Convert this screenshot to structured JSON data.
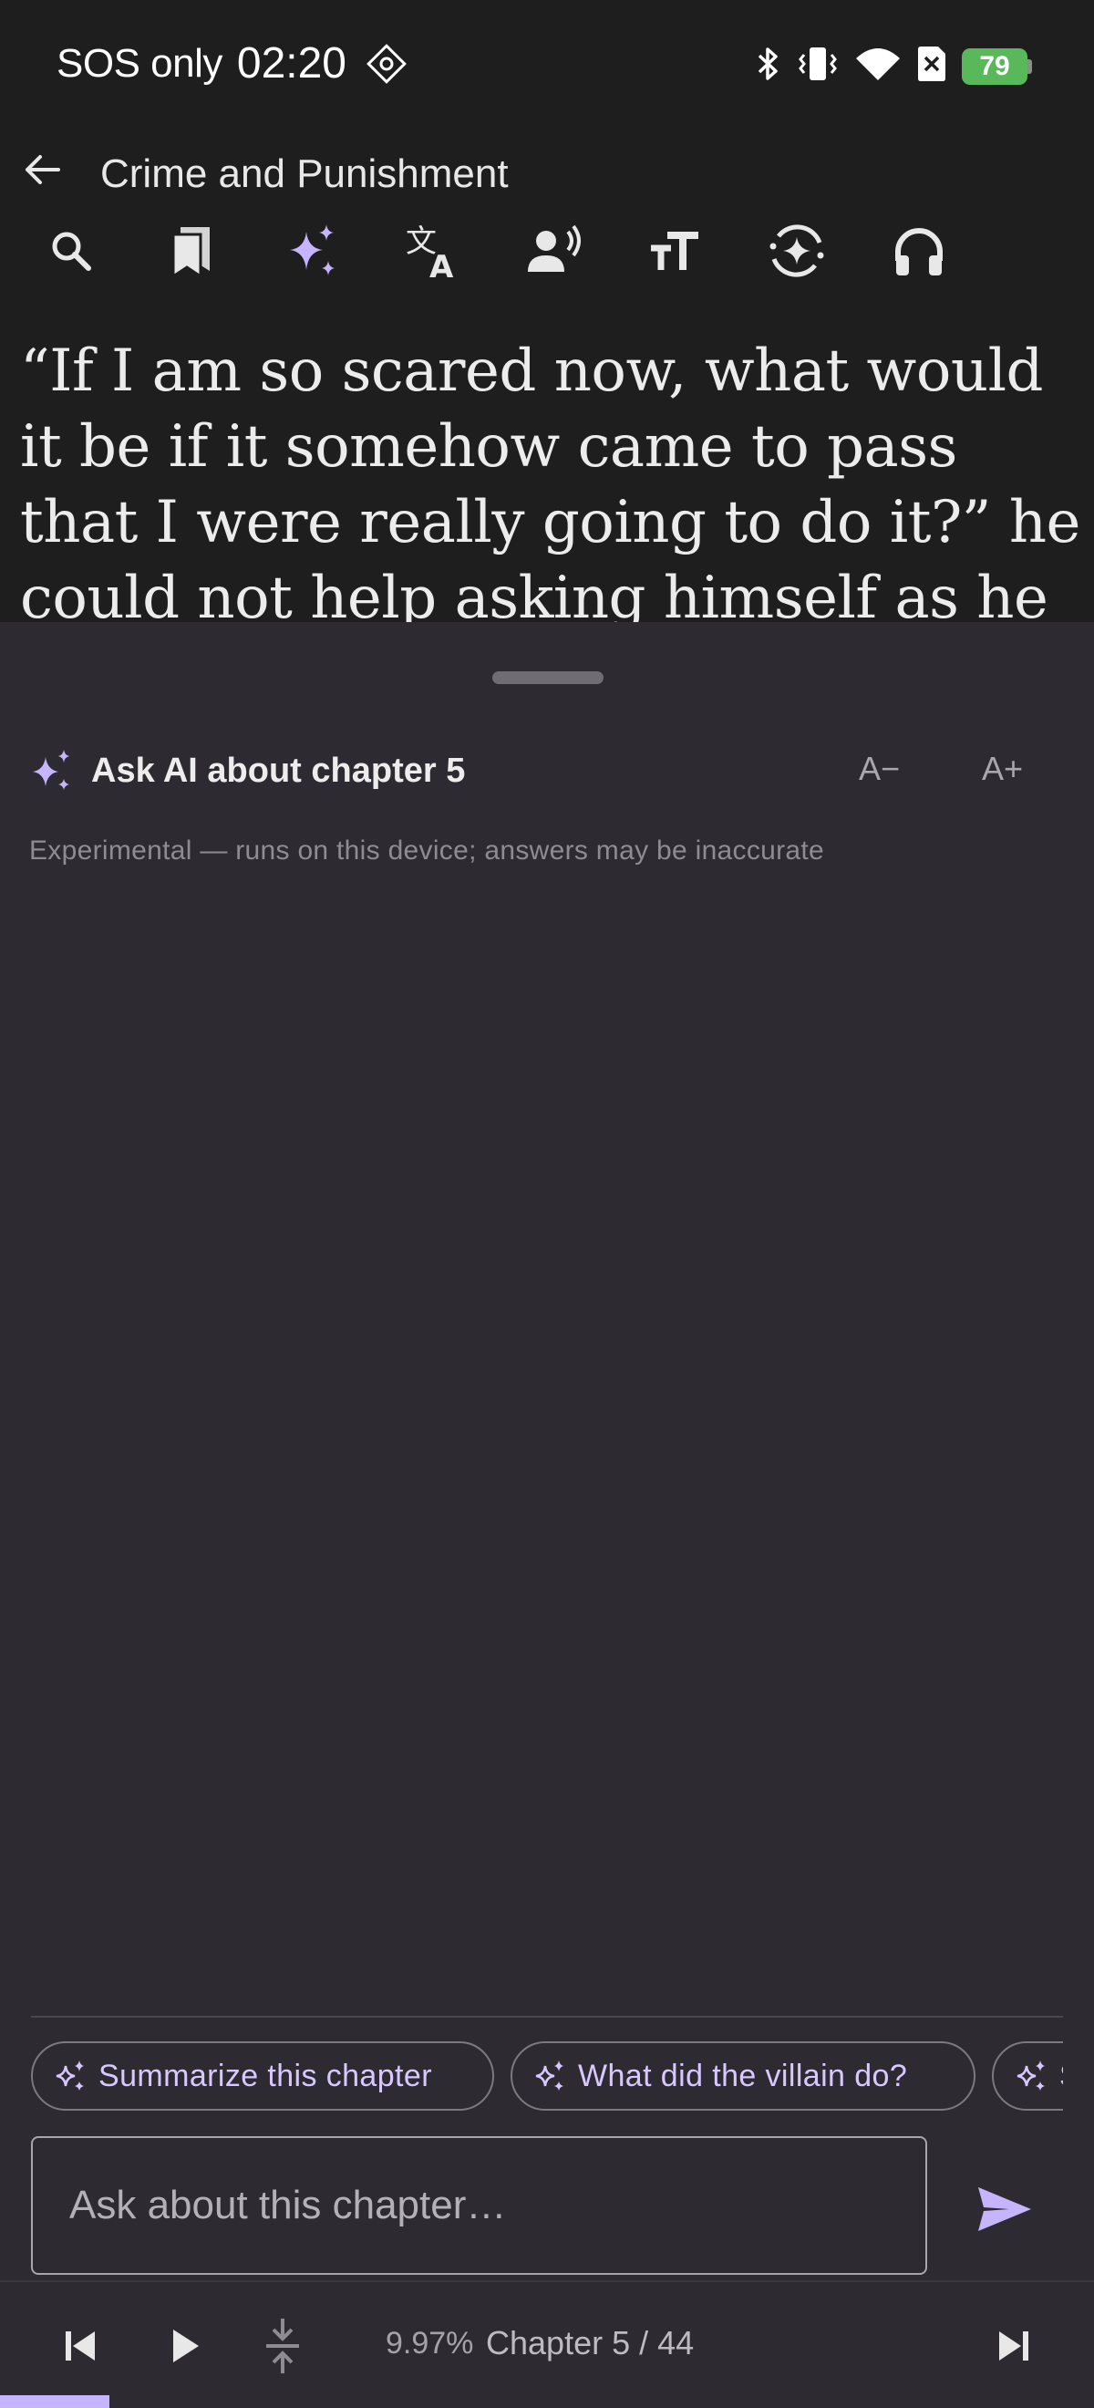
{
  "status_bar": {
    "carrier": "SOS only",
    "time": "02:20",
    "battery": "79",
    "icons": [
      "dnd-icon",
      "bluetooth-icon",
      "vibrate-icon",
      "wifi-icon",
      "no-sim-icon",
      "battery-icon"
    ]
  },
  "header": {
    "title": "Crime and Punishment",
    "toolbar": [
      "search-icon",
      "bookmarks-icon",
      "ai-sparkle-icon",
      "translate-icon",
      "voice-read-icon",
      "text-size-icon",
      "lens-icon",
      "headphones-icon"
    ]
  },
  "reading": {
    "text": "“If I am so scared now, what would it be if it somehow came to pass that I were really going to do it?” he could not help asking himself as he"
  },
  "ai_sheet": {
    "title": "Ask AI about chapter 5",
    "font_decrease": "A−",
    "font_increase": "A+",
    "disclaimer": "Experimental — runs on this device; answers may be inaccurate",
    "suggestions": [
      "Summarize this chapter",
      "What did the villain do?",
      "S"
    ],
    "input_placeholder": "Ask about this chapter…"
  },
  "bottom_nav": {
    "progress": "9.97%",
    "chapter": "Chapter 5 / 44"
  },
  "colors": {
    "accent": "#c6b4ff",
    "sheet_bg": "#2d2b31",
    "page_bg": "#1e1e1e",
    "battery": "#58b85a"
  }
}
